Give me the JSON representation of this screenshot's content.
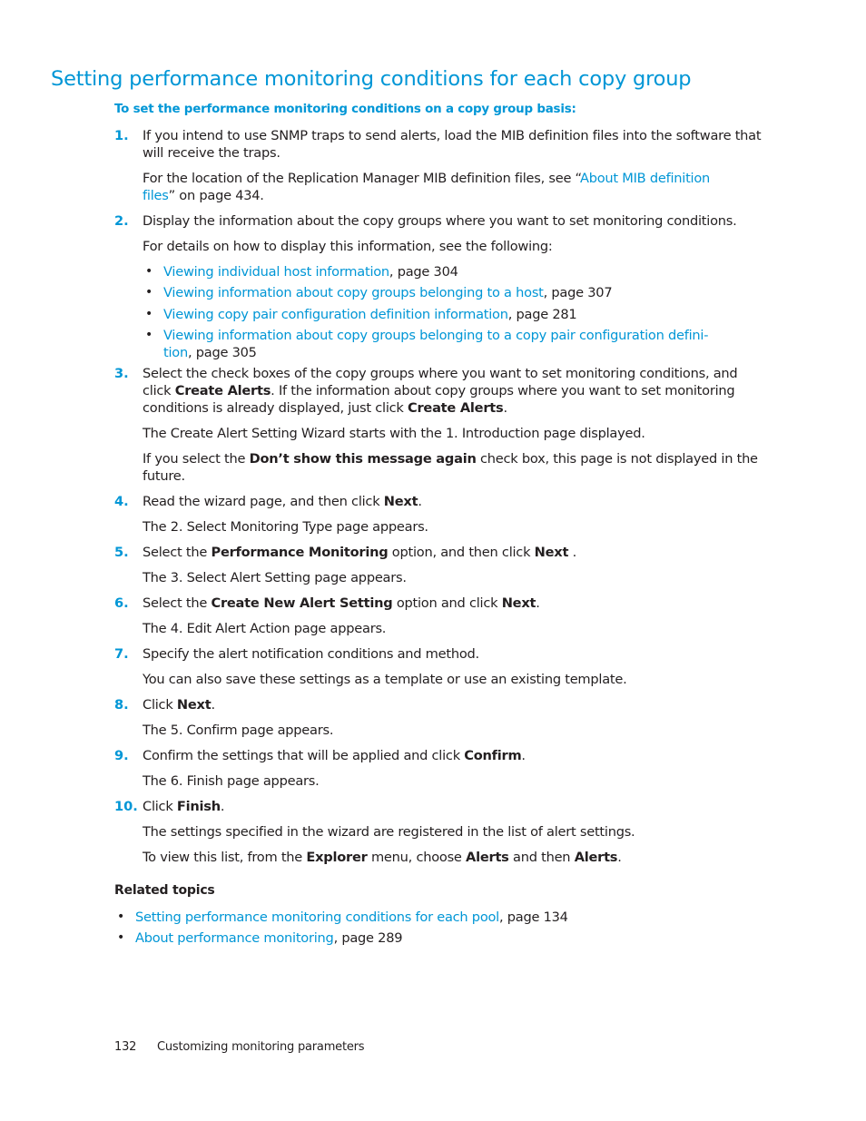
{
  "heading": {
    "title": "Setting performance monitoring conditions for each copy group",
    "procedure_title": "To set the performance monitoring conditions on a copy group basis:"
  },
  "steps": [
    {
      "number": "1.",
      "text_a": "If you intend to use SNMP traps to send alerts,  load the MIB definition files into the software that",
      "text_b": "will receive the traps.",
      "para_a": "For the location of the Replication Manager MIB definition files, see “",
      "para_link_a": "About MIB definition",
      "para_link_b": "files",
      "para_b": "” on page 434."
    },
    {
      "number": "2.",
      "text": "Display the information about the copy groups where you want to set monitoring conditions.",
      "para": "For details on how to display this information, see the following:",
      "bullets": [
        {
          "link": "Viewing individual host information",
          "page": ", page 304"
        },
        {
          "link": "Viewing information about copy groups belonging to a host",
          "page": ", page 307"
        },
        {
          "link": "Viewing copy pair configuration definition information",
          "page": ", page 281"
        },
        {
          "link": "Viewing information about copy groups belonging to a copy pair configuration defini-",
          "link_cont": "tion",
          "page": ", page 305"
        }
      ]
    },
    {
      "number": "3.",
      "text_a": "Select the check boxes of the copy groups where you want to set monitoring conditions, and",
      "text_b1": "click ",
      "bold_b1": "Create Alerts",
      "text_b2": ". If the information about copy groups where you want to set monitoring",
      "text_c1": "conditions is already displayed, just click ",
      "bold_c1": "Create Alerts",
      "text_c2": ".",
      "para_1": "The Create Alert Setting Wizard starts with the 1. Introduction page displayed.",
      "para_2a": "If you select the ",
      "para_2_bold": "Don’t show this message again",
      "para_2b": " check box, this page is not displayed in the",
      "para_2c": "future."
    },
    {
      "number": "4.",
      "text_a": "Read the wizard page, and then click ",
      "bold": "Next",
      "text_b": ".",
      "para": "The 2. Select Monitoring Type page appears."
    },
    {
      "number": "5.",
      "text_a": "Select the ",
      "bold_a": "Performance Monitoring",
      "text_b": " option, and then click ",
      "bold_b": "Next",
      "text_c": " .",
      "para": "The 3. Select Alert Setting page appears."
    },
    {
      "number": "6.",
      "text_a": "Select the ",
      "bold_a": "Create New Alert Setting",
      "text_b": " option and click ",
      "bold_b": "Next",
      "text_c": ".",
      "para": "The 4. Edit Alert Action page appears."
    },
    {
      "number": "7.",
      "text": "Specify the alert notification conditions and method.",
      "para": "You can also save these settings as a template or use an existing template."
    },
    {
      "number": "8.",
      "text_a": "Click ",
      "bold": "Next",
      "text_b": ".",
      "para": "The 5. Confirm page appears."
    },
    {
      "number": "9.",
      "text_a": "Confirm the settings that will be applied and click ",
      "bold": "Confirm",
      "text_b": ".",
      "para": "The 6. Finish page appears."
    },
    {
      "number": "10.",
      "text_a": "Click ",
      "bold": "Finish",
      "text_b": ".",
      "para_1": "The settings specified in the wizard are registered in the list of alert settings.",
      "para_2a": "To view this list, from the ",
      "para_2_bold1": "Explorer",
      "para_2b": " menu, choose ",
      "para_2_bold2": "Alerts",
      "para_2c": " and then ",
      "para_2_bold3": "Alerts",
      "para_2d": "."
    }
  ],
  "related": {
    "heading": "Related topics",
    "items": [
      {
        "link": "Setting performance monitoring conditions for each pool",
        "page": ", page 134"
      },
      {
        "link": "About performance monitoring",
        "page": ", page 289"
      }
    ]
  },
  "footer": {
    "page_number": "132",
    "chapter": "Customizing monitoring parameters"
  },
  "bullet_glyph": "•",
  "colors": {
    "accent": "#0096d6",
    "text": "#231f20"
  }
}
